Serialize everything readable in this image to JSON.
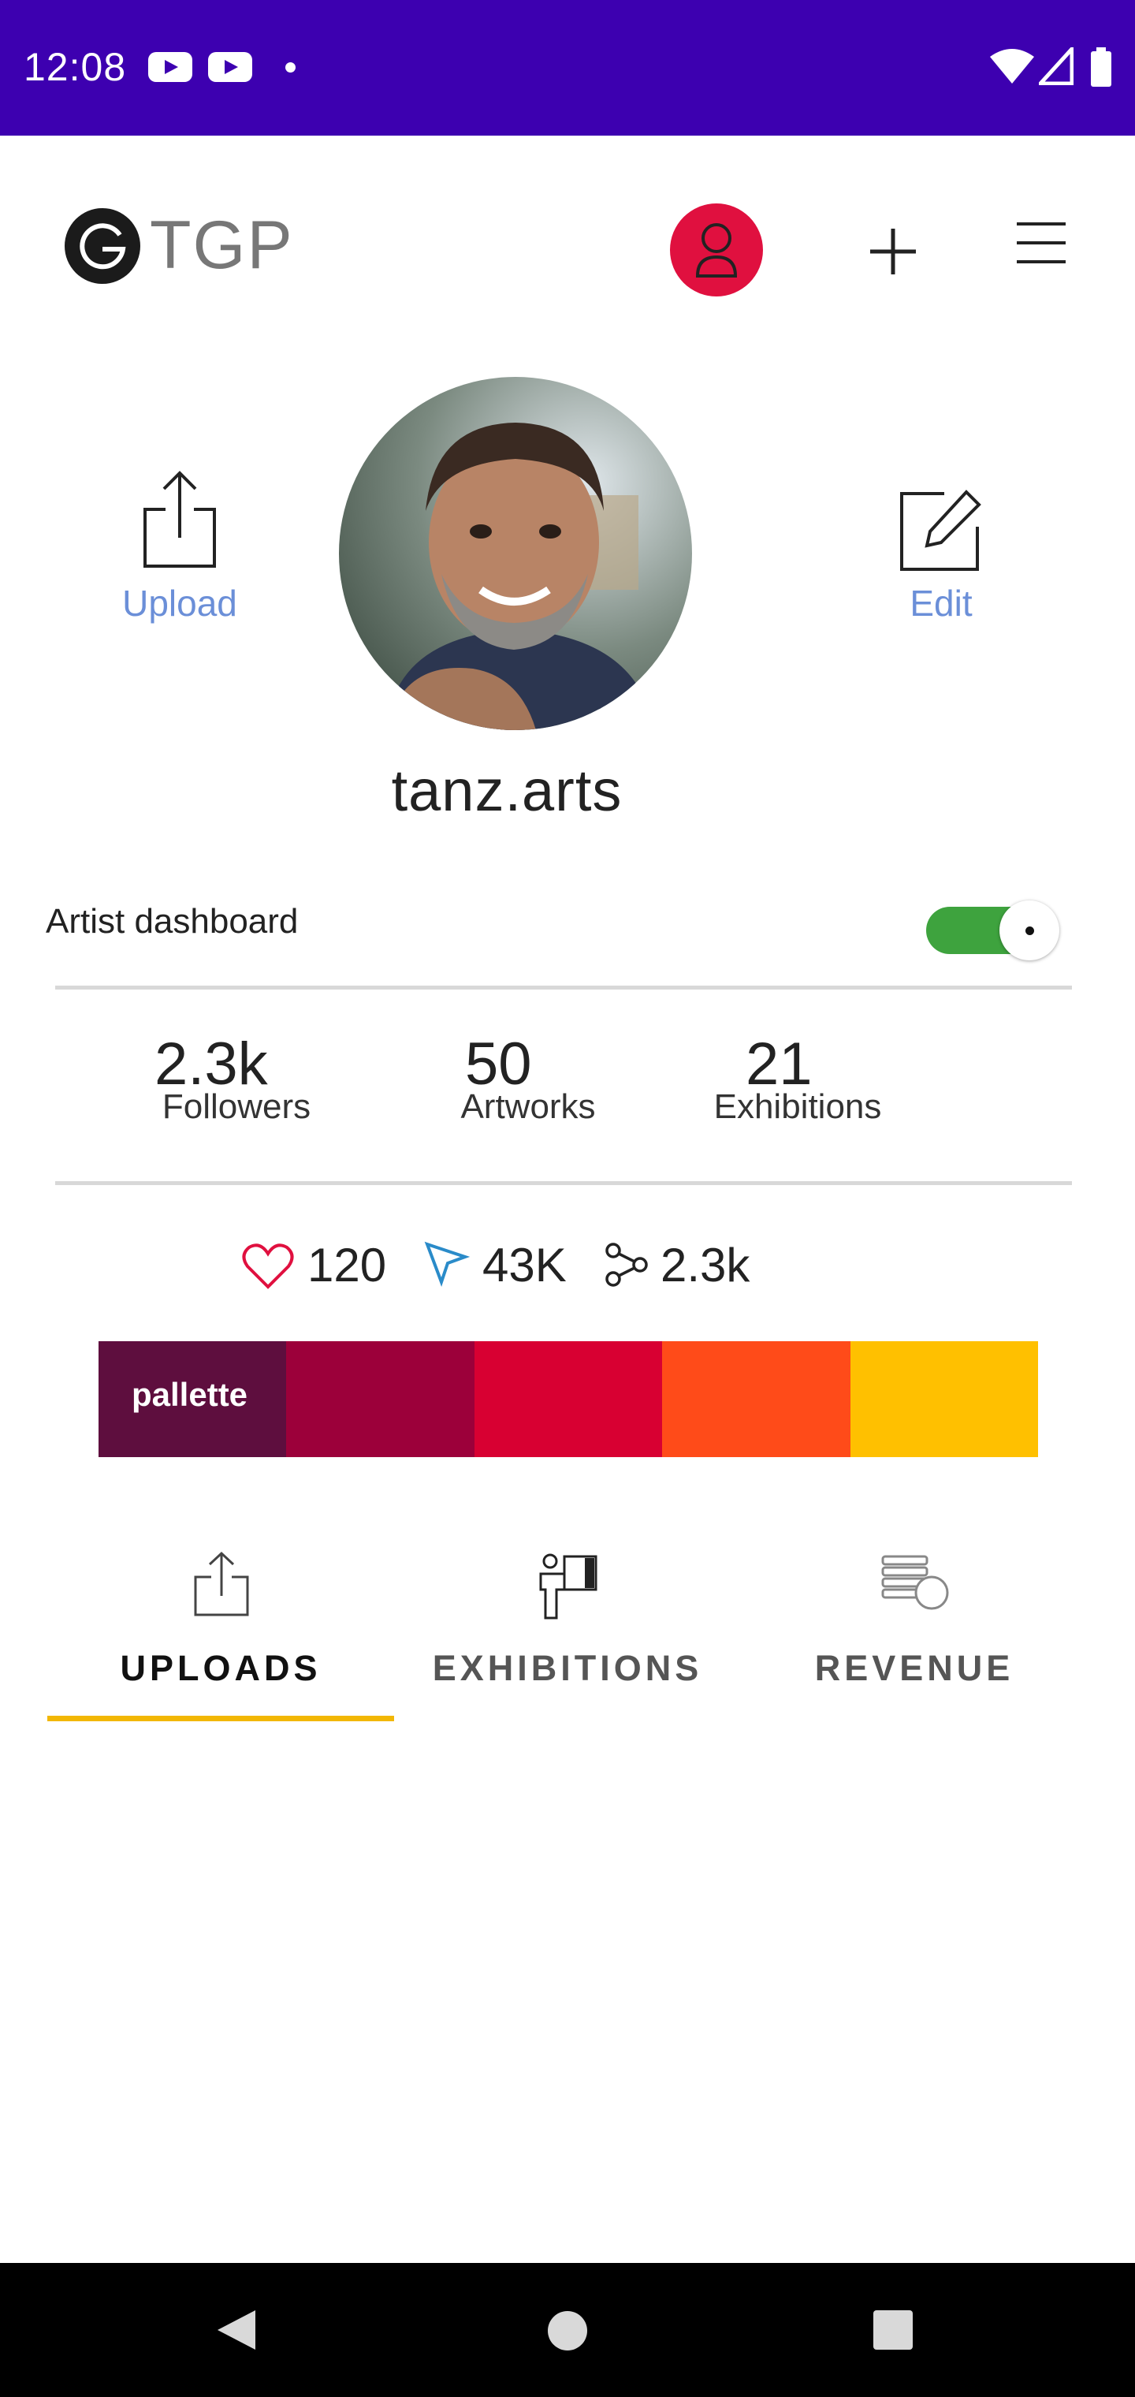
{
  "status_bar": {
    "time": "12:08",
    "icons": [
      "youtube-icon",
      "youtube-icon",
      "notification-dot-icon",
      "wifi-icon",
      "signal-icon",
      "battery-icon"
    ]
  },
  "header": {
    "logo_text": "TGP",
    "icons": [
      "profile-icon",
      "plus-icon",
      "menu-icon"
    ]
  },
  "profile": {
    "upload_label": "Upload",
    "edit_label": "Edit",
    "username": "tanz.arts"
  },
  "dashboard": {
    "label": "Artist dashboard",
    "toggle_on": true
  },
  "stats": [
    {
      "value": "2.3k",
      "label": "Followers"
    },
    {
      "value": "50",
      "label": "Artworks"
    },
    {
      "value": "21",
      "label": "Exhibitions"
    }
  ],
  "engagement": {
    "likes": "120",
    "views": "43K",
    "shares": "2.3k"
  },
  "palette": {
    "label": "pallette",
    "colors": [
      "#5e0e3e",
      "#9c003a",
      "#d80032",
      "#ff4b19",
      "#ffc000"
    ]
  },
  "tabs": [
    {
      "label": "UPLOADS",
      "active": true
    },
    {
      "label": "EXHIBITIONS",
      "active": false
    },
    {
      "label": "REVENUE",
      "active": false
    }
  ],
  "colors": {
    "status_bar": "#3d00b0",
    "accent_red": "#e0103f",
    "link_blue": "#6b8fd8",
    "toggle_green": "#3ea33e",
    "tab_underline": "#f2b705"
  }
}
